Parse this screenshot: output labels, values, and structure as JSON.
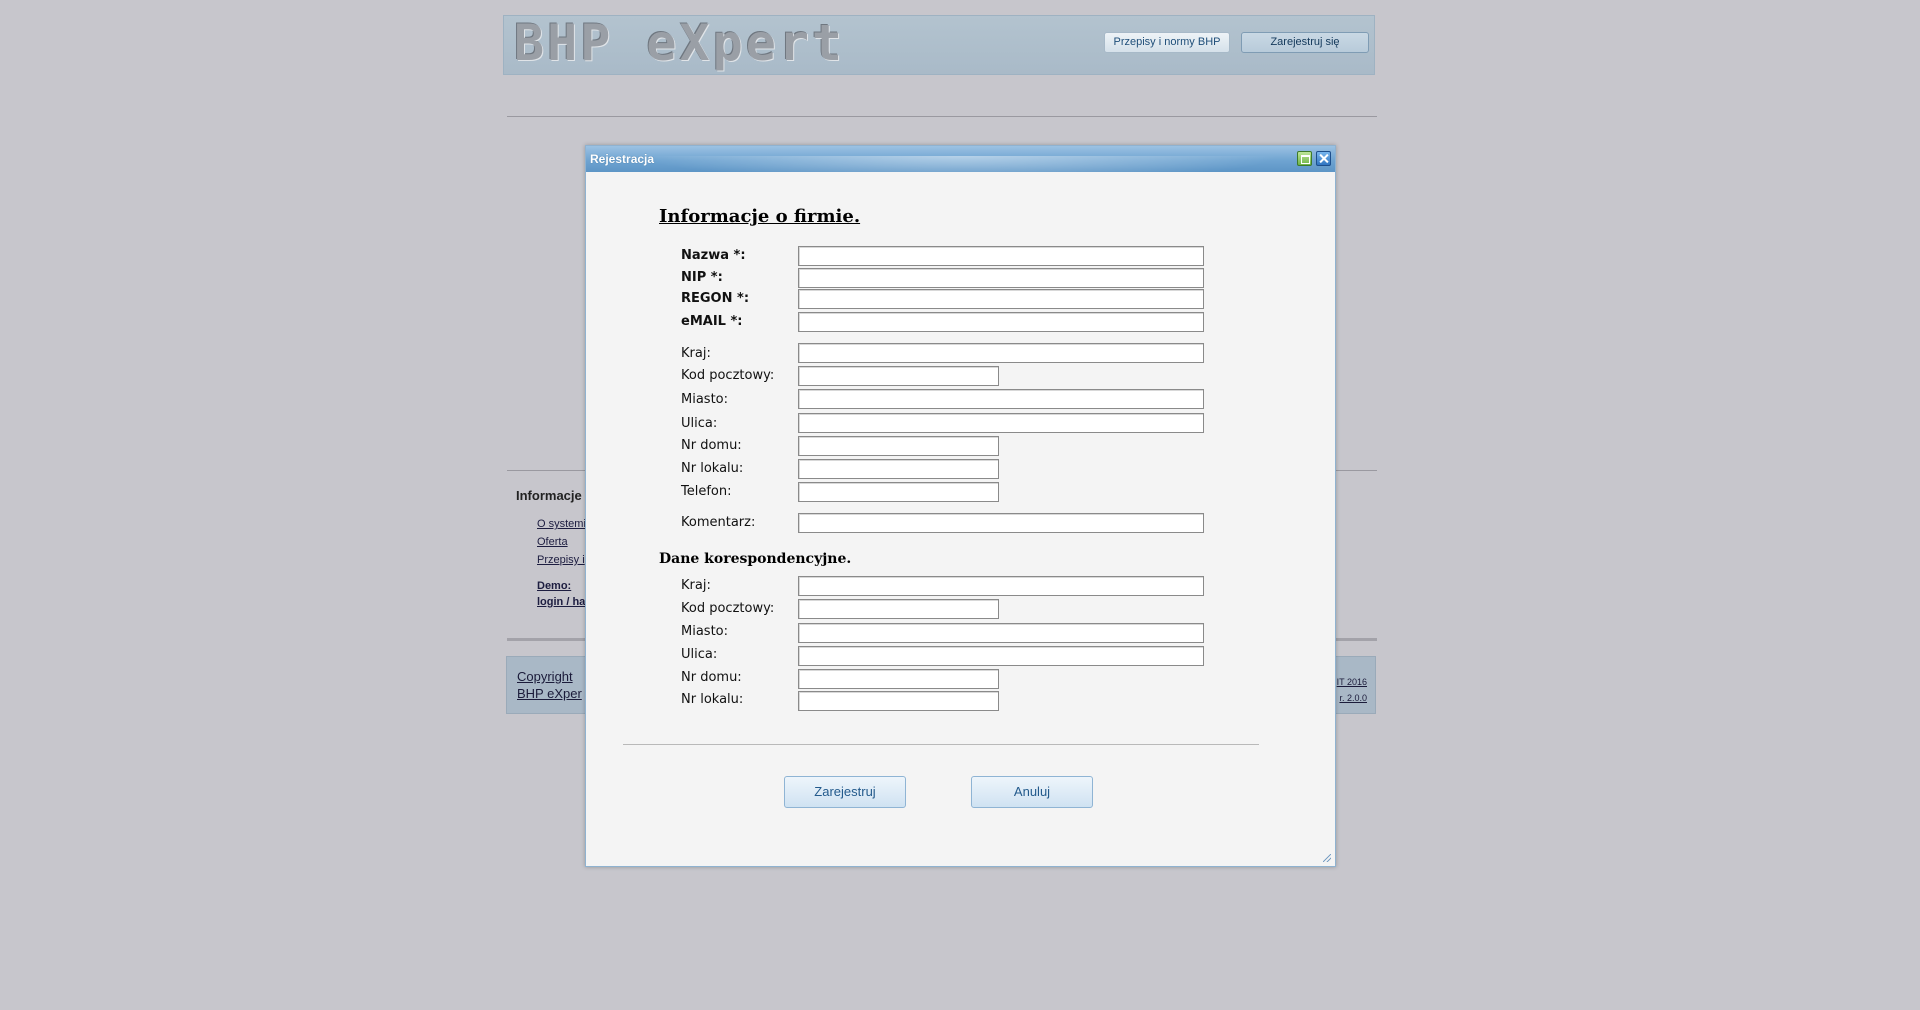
{
  "header": {
    "logo": "BHP eXpert",
    "laws_button": "Przepisy i normy BHP",
    "register_button": "Zarejestruj się"
  },
  "footer": {
    "info_title": "Informacje",
    "links": [
      "O systemi",
      "Oferta",
      "Przepisy i"
    ],
    "demo_label": "Demo:",
    "demo_login": "login / ha",
    "copyright_line1": "Copyright",
    "copyright_line2": "BHP eXper",
    "right_line1": "IT 2016",
    "right_line2": "r. 2.0.0"
  },
  "dialog": {
    "title": "Rejestracja",
    "section_company": "Informacje o firmie.",
    "required_fields": {
      "name": "Nazwa *:",
      "nip": "NIP *:",
      "regon": "REGON *:",
      "email": "eMAIL *:"
    },
    "address_fields": {
      "country": "Kraj:",
      "postal": "Kod pocztowy:",
      "city": "Miasto:",
      "street": "Ulica:",
      "house": "Nr domu:",
      "apartment": "Nr lokalu:",
      "phone": "Telefon:",
      "comment": "Komentarz:"
    },
    "section_correspondence": "Dane korespondencyjne.",
    "correspondence_fields": {
      "country": "Kraj:",
      "postal": "Kod pocztowy:",
      "city": "Miasto:",
      "street": "Ulica:",
      "house": "Nr domu:",
      "apartment": "Nr lokalu:"
    },
    "submit_button": "Zarejestruj",
    "cancel_button": "Anuluj"
  }
}
